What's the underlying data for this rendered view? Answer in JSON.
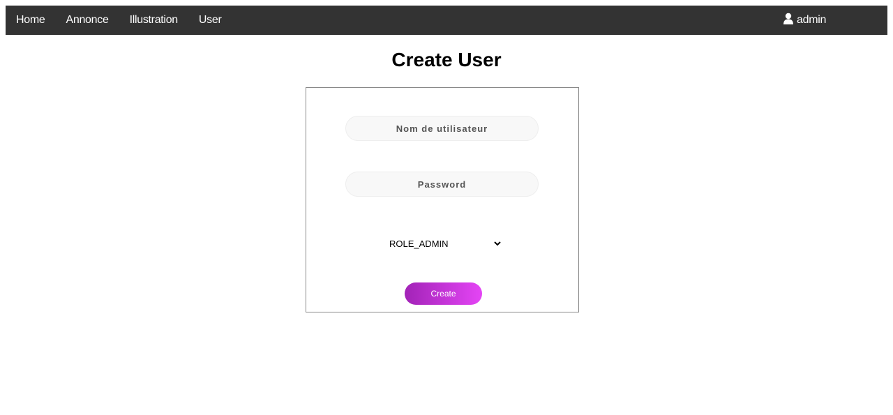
{
  "nav": {
    "links": [
      "Home",
      "Annonce",
      "Illustration",
      "User"
    ],
    "user_icon": "user-icon",
    "user_label": "admin",
    "background": "#333333"
  },
  "page": {
    "title": "Create User"
  },
  "form": {
    "username_placeholder": "Nom de utilisateur",
    "username_value": "",
    "password_placeholder": "Password",
    "password_value": "",
    "role_selected": "ROLE_ADMIN",
    "role_icon": "chevron-down-icon",
    "submit_label": "Create",
    "submit_gradient": [
      "#a223b7",
      "#e445f5"
    ]
  }
}
